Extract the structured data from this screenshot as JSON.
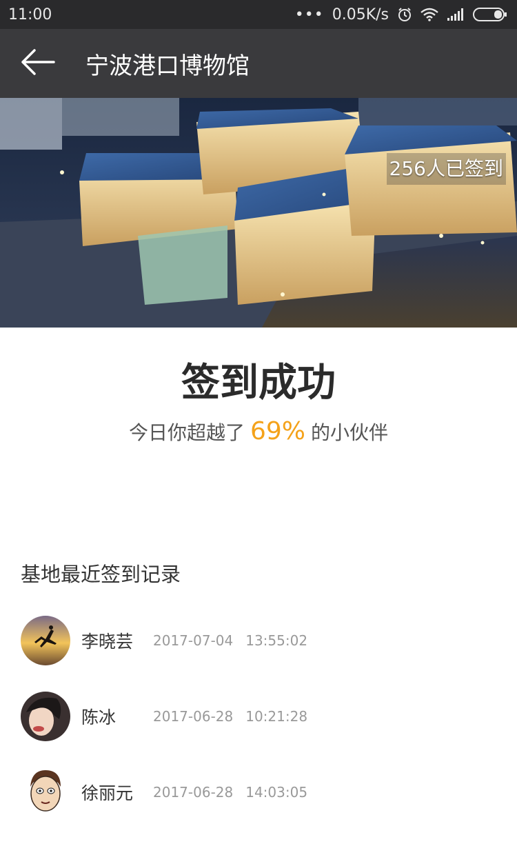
{
  "status_bar": {
    "time": "11:00",
    "network_speed": "0.05K/s",
    "icons": [
      "more-dots-icon",
      "alarm-icon",
      "wifi-icon",
      "signal-icon",
      "battery-icon"
    ]
  },
  "nav": {
    "title": "宁波港口博物馆",
    "back_icon": "back-arrow-icon"
  },
  "hero": {
    "checkin_count": "256人已签到"
  },
  "result": {
    "title": "签到成功",
    "sub_prefix": "今日你超越了",
    "percent": "69%",
    "sub_suffix": "的小伙伴",
    "accent_color": "#f4a21a"
  },
  "records": {
    "title": "基地最近签到记录",
    "items": [
      {
        "name": "李晓芸",
        "date": "2017-07-04",
        "time": "13:55:02"
      },
      {
        "name": "陈冰",
        "date": "2017-06-28",
        "time": "10:21:28"
      },
      {
        "name": "徐丽元",
        "date": "2017-06-28",
        "time": "14:03:05"
      }
    ]
  }
}
